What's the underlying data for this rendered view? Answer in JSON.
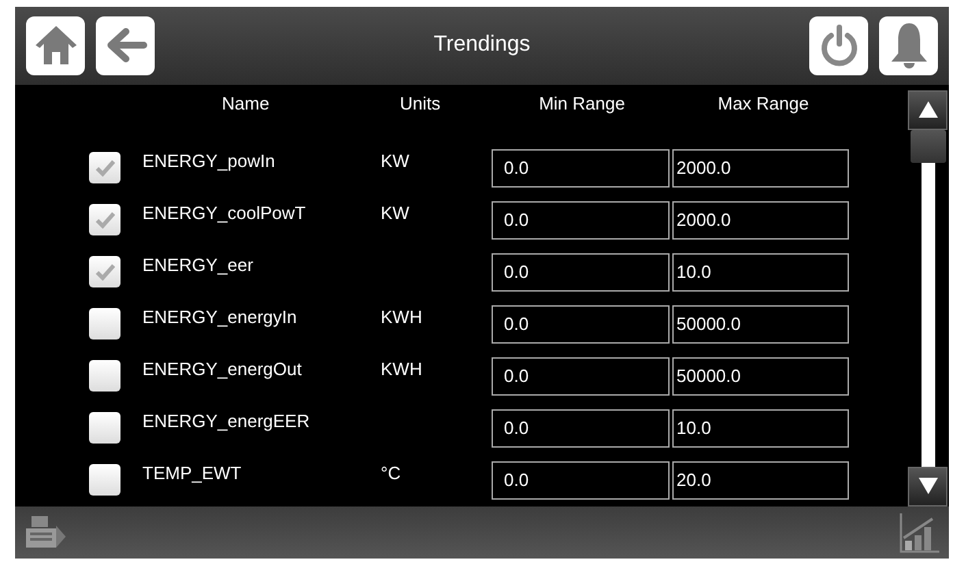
{
  "header": {
    "title": "Trendings"
  },
  "table": {
    "columns": [
      "Name",
      "Units",
      "Min Range",
      "Max Range"
    ],
    "rows": [
      {
        "checked": true,
        "name": "ENERGY_powIn",
        "units": "KW",
        "min": "0.0",
        "max": "2000.0"
      },
      {
        "checked": true,
        "name": "ENERGY_coolPowT",
        "units": "KW",
        "min": "0.0",
        "max": "2000.0"
      },
      {
        "checked": true,
        "name": "ENERGY_eer",
        "min": "0.0",
        "max": "10.0"
      },
      {
        "checked": false,
        "name": "ENERGY_energyIn",
        "units": "KWH",
        "min": "0.0",
        "max": "50000.0"
      },
      {
        "checked": false,
        "name": "ENERGY_energOut",
        "units": "KWH",
        "min": "0.0",
        "max": "50000.0"
      },
      {
        "checked": false,
        "name": "ENERGY_energEER",
        "min": "0.0",
        "max": "10.0"
      },
      {
        "checked": false,
        "name": "TEMP_EWT",
        "units": "°C",
        "min": "0.0",
        "max": "20.0"
      }
    ]
  }
}
